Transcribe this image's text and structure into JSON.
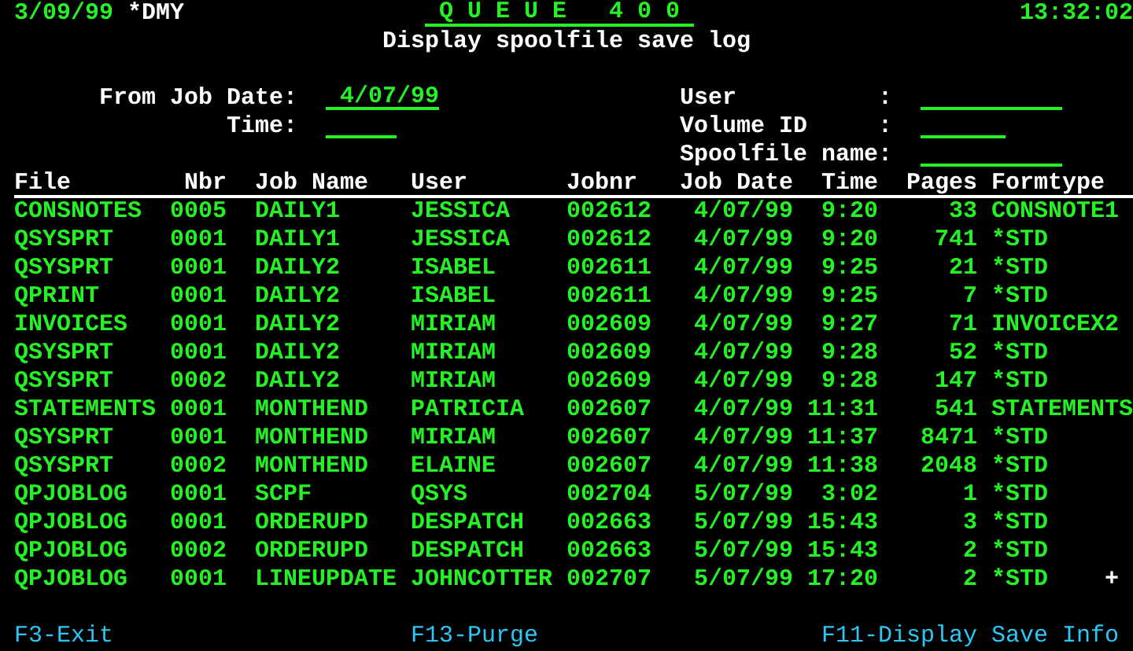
{
  "header": {
    "date": "3/09/99",
    "date_format": "*DMY",
    "app_title": "Q U E U E   4 0 0",
    "time": "13:32:02",
    "screen_title": "Display spoolfile save log"
  },
  "filters_left": [
    {
      "label": "From Job Date:",
      "value": "4/07/99"
    },
    {
      "label": "Time:"
    }
  ],
  "filters_right": [
    {
      "label": "User",
      "separator": ":"
    },
    {
      "label": "Volume ID",
      "separator": ":"
    },
    {
      "label": "Spoolfile name",
      "separator": ":"
    }
  ],
  "table": {
    "columns": [
      "File",
      "Nbr",
      "Job Name",
      "User",
      "Jobnr",
      "Job Date",
      "Time",
      "Pages",
      "Formtype"
    ],
    "rows": [
      [
        "CONSNOTES",
        "0005",
        "DAILY1",
        "JESSICA",
        "002612",
        "4/07/99",
        "9:20",
        "33",
        "CONSNOTE1"
      ],
      [
        "QSYSPRT",
        "0001",
        "DAILY1",
        "JESSICA",
        "002612",
        "4/07/99",
        "9:20",
        "741",
        "*STD"
      ],
      [
        "QSYSPRT",
        "0001",
        "DAILY2",
        "ISABEL",
        "002611",
        "4/07/99",
        "9:25",
        "21",
        "*STD"
      ],
      [
        "QPRINT",
        "0001",
        "DAILY2",
        "ISABEL",
        "002611",
        "4/07/99",
        "9:25",
        "7",
        "*STD"
      ],
      [
        "INVOICES",
        "0001",
        "DAILY2",
        "MIRIAM",
        "002609",
        "4/07/99",
        "9:27",
        "71",
        "INVOICEX2"
      ],
      [
        "QSYSPRT",
        "0001",
        "DAILY2",
        "MIRIAM",
        "002609",
        "4/07/99",
        "9:28",
        "52",
        "*STD"
      ],
      [
        "QSYSPRT",
        "0002",
        "DAILY2",
        "MIRIAM",
        "002609",
        "4/07/99",
        "9:28",
        "147",
        "*STD"
      ],
      [
        "STATEMENTS",
        "0001",
        "MONTHEND",
        "PATRICIA",
        "002607",
        "4/07/99",
        "11:31",
        "541",
        "STATEMENTS"
      ],
      [
        "QSYSPRT",
        "0001",
        "MONTHEND",
        "MIRIAM",
        "002607",
        "4/07/99",
        "11:37",
        "8471",
        "*STD"
      ],
      [
        "QSYSPRT",
        "0002",
        "MONTHEND",
        "ELAINE",
        "002607",
        "4/07/99",
        "11:38",
        "2048",
        "*STD"
      ],
      [
        "QPJOBLOG",
        "0001",
        "SCPF",
        "QSYS",
        "002704",
        "5/07/99",
        "3:02",
        "1",
        "*STD"
      ],
      [
        "QPJOBLOG",
        "0001",
        "ORDERUPD",
        "DESPATCH",
        "002663",
        "5/07/99",
        "15:43",
        "3",
        "*STD"
      ],
      [
        "QPJOBLOG",
        "0002",
        "ORDERUPD",
        "DESPATCH",
        "002663",
        "5/07/99",
        "15:43",
        "2",
        "*STD"
      ],
      [
        "QPJOBLOG",
        "0001",
        "LINEUPDATE",
        "JOHNCOTTER",
        "002707",
        "5/07/99",
        "17:20",
        "2",
        "*STD"
      ]
    ]
  },
  "more_indicator": "+",
  "function_keys": [
    "F3-Exit",
    "F13-Purge",
    "F11-Display Save Info"
  ]
}
